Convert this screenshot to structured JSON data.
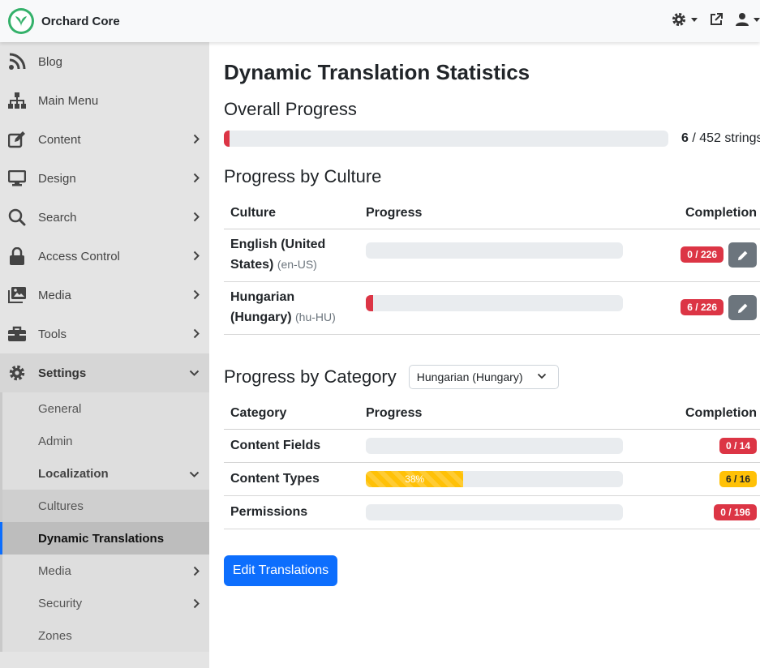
{
  "app": {
    "name": "Orchard Core"
  },
  "sidebar": {
    "items": [
      {
        "label": "Blog",
        "icon": "rss-icon"
      },
      {
        "label": "Main Menu",
        "icon": "sitemap-icon"
      },
      {
        "label": "Content",
        "icon": "edit-icon"
      },
      {
        "label": "Design",
        "icon": "monitor-icon"
      },
      {
        "label": "Search",
        "icon": "search-icon"
      },
      {
        "label": "Access Control",
        "icon": "lock-icon"
      },
      {
        "label": "Media",
        "icon": "images-icon"
      },
      {
        "label": "Tools",
        "icon": "toolbox-icon"
      },
      {
        "label": "Settings",
        "icon": "gear-icon"
      }
    ],
    "settings_children": [
      "General",
      "Admin",
      "Localization"
    ],
    "localization_children": [
      "Cultures",
      "Dynamic Translations"
    ],
    "settings_children_after": [
      "Media",
      "Security",
      "Zones"
    ]
  },
  "page": {
    "title": "Dynamic Translation Statistics",
    "overall": {
      "title": "Overall Progress",
      "translated": "6",
      "total_text": " / 452 strings",
      "progress_fraction": 0.013
    },
    "by_culture": {
      "title": "Progress by Culture",
      "headers": {
        "culture": "Culture",
        "progress": "Progress",
        "completion": "Completion"
      },
      "rows": [
        {
          "name": "English (United States)",
          "code": "(en-US)",
          "completion": "0 / 226",
          "progress_fraction": 0.0
        },
        {
          "name": "Hungarian (Hungary)",
          "code": "(hu-HU)",
          "completion": "6 / 226",
          "progress_fraction": 0.027
        }
      ]
    },
    "by_category": {
      "title": "Progress by Category",
      "selected_culture": "Hungarian (Hungary)",
      "headers": {
        "category": "Category",
        "progress": "Progress",
        "completion": "Completion"
      },
      "rows": [
        {
          "name": "Content Fields",
          "completion": "0 / 14",
          "progress_fraction": 0.0,
          "progress_label": ""
        },
        {
          "name": "Content Types",
          "completion": "6 / 16",
          "progress_fraction": 0.38,
          "progress_label": "38%"
        },
        {
          "name": "Permissions",
          "completion": "0 / 196",
          "progress_fraction": 0.0,
          "progress_label": ""
        }
      ]
    },
    "edit_button": "Edit Translations"
  },
  "colors": {
    "primary": "#0d6efd",
    "danger": "#dc3545",
    "warning": "#ffc107",
    "brand": "#34b16a"
  }
}
